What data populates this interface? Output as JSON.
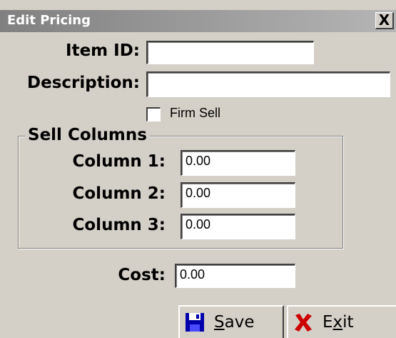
{
  "window": {
    "title": "Edit Pricing",
    "close_label": "X"
  },
  "form": {
    "item_id_label": "Item ID:",
    "item_id_value": "",
    "description_label": "Description:",
    "description_value": "",
    "firm_sell_label": "Firm Sell",
    "firm_sell_checked": false
  },
  "sell_columns": {
    "group_title": "Sell Columns",
    "columns": [
      {
        "label": "Column 1:",
        "value": "0.00"
      },
      {
        "label": "Column 2:",
        "value": "0.00"
      },
      {
        "label": "Column 3:",
        "value": "0.00"
      }
    ]
  },
  "cost": {
    "label": "Cost:",
    "value": "0.00"
  },
  "buttons": {
    "save_mnemonic": "S",
    "save_rest": "ave",
    "save_icon": "floppy-disk-icon",
    "exit_pre": "E",
    "exit_mnemonic": "x",
    "exit_rest": "it",
    "exit_icon": "red-x-icon"
  },
  "colors": {
    "face": "#d4d0c8",
    "title_gradient_start": "#808080",
    "title_gradient_end": "#b5b5b5",
    "save_icon_color": "#0000aa",
    "exit_icon_color": "#cc0000"
  }
}
